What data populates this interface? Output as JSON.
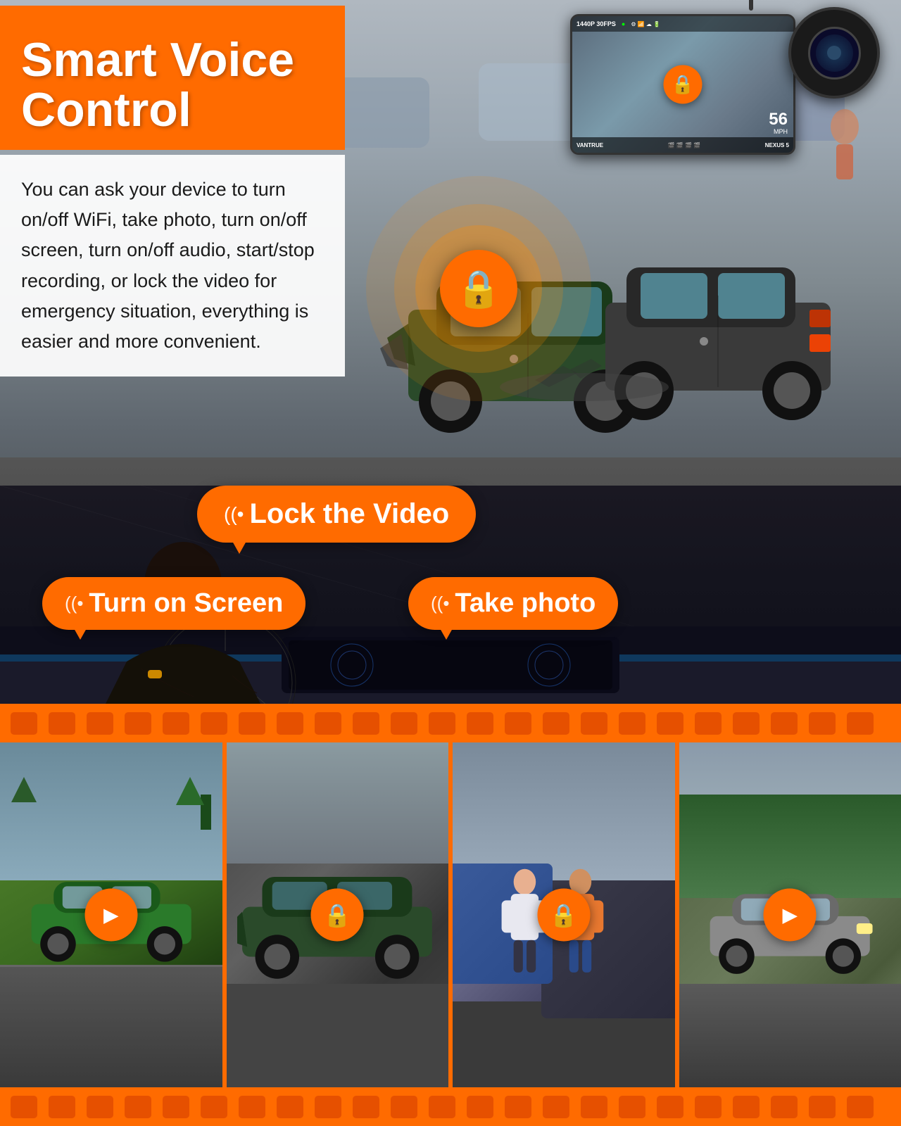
{
  "header": {
    "title_line1": "Smart Voice",
    "title_line2": "Control"
  },
  "description": {
    "text": "You can ask your device to turn on/off WiFi, take photo, turn on/off screen, turn on/off audio, start/stop recording, or lock the video for emergency situation, everything is easier and more convenient."
  },
  "voice_commands": {
    "lock_video": "Lock the Video",
    "turn_on_screen": "Turn on Screen",
    "take_photo": "Take photo"
  },
  "dashcam": {
    "brand": "VANTRUE",
    "model": "NEXUS 5",
    "resolution": "1440P 30FPS",
    "speed": "56",
    "speed_unit": "MPH"
  },
  "thumbnails": [
    {
      "id": 1,
      "type": "play",
      "icon": "▶"
    },
    {
      "id": 2,
      "type": "lock",
      "icon": "🔒"
    },
    {
      "id": 3,
      "type": "lock",
      "icon": "🔒"
    },
    {
      "id": 4,
      "type": "play",
      "icon": "▶"
    }
  ],
  "colors": {
    "orange": "#FF6B00",
    "dark_orange": "#e65c00",
    "white": "#ffffff",
    "dark": "#1a1a1a"
  }
}
